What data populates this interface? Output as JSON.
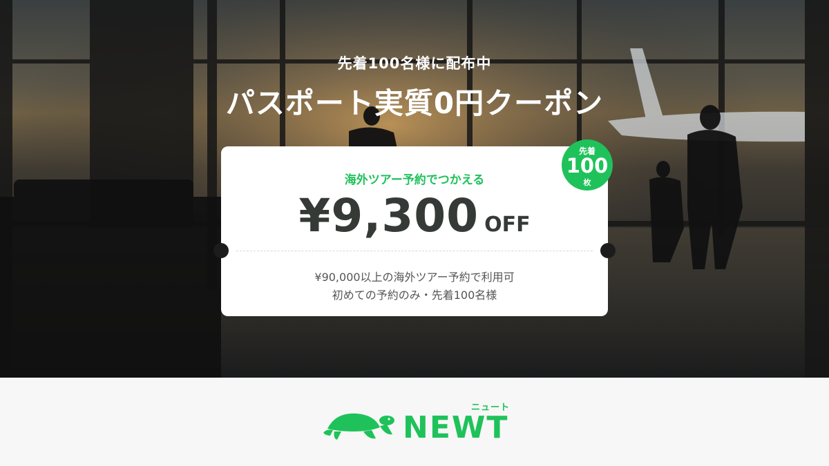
{
  "hero": {
    "kicker": "先着100名様に配布中",
    "headline": "パスポート実質0円クーポン"
  },
  "coupon": {
    "subtitle": "海外ツアー予約でつかえる",
    "amount": "¥9,300",
    "off_label": "OFF",
    "condition_1": "¥90,000以上の海外ツアー予約で利用可",
    "condition_2": "初めての予約のみ・先着100名様"
  },
  "badge": {
    "top": "先着",
    "number": "100",
    "unit": "枚"
  },
  "footer": {
    "logo_word": "NEWT",
    "logo_kana": "ニュート"
  },
  "colors": {
    "brand_green": "#1fc25a",
    "amount_text": "#353a37",
    "coupon_bg": "#ffffff",
    "footer_bg": "#f7f7f7"
  }
}
